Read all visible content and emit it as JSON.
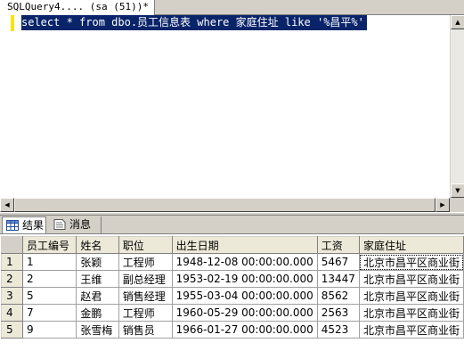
{
  "document_tab": {
    "label": "SQLQuery4....  (sa (51))*"
  },
  "editor": {
    "sql": "select * from dbo.员工信息表 where 家庭住址 like '%昌平%'"
  },
  "results_tabs": [
    {
      "label": "结果",
      "icon": "grid-icon"
    },
    {
      "label": "消息",
      "icon": "messages-icon"
    }
  ],
  "grid": {
    "columns": [
      "员工编号",
      "姓名",
      "职位",
      "出生日期",
      "工资",
      "家庭住址"
    ],
    "rows": [
      {
        "num": "1",
        "cells": [
          "1",
          "张颖",
          "工程师",
          "1948-12-08 00:00:00.000",
          "5467",
          "北京市昌平区商业街"
        ]
      },
      {
        "num": "2",
        "cells": [
          "2",
          "王维",
          "副总经理",
          "1953-02-19 00:00:00.000",
          "13447",
          "北京市昌平区商业街"
        ]
      },
      {
        "num": "3",
        "cells": [
          "5",
          "赵君",
          "销售经理",
          "1955-03-04 00:00:00.000",
          "8562",
          "北京市昌平区商业街"
        ]
      },
      {
        "num": "4",
        "cells": [
          "7",
          "金鹏",
          "工程师",
          "1960-05-29 00:00:00.000",
          "2563",
          "北京市昌平区商业街"
        ]
      },
      {
        "num": "5",
        "cells": [
          "9",
          "张雪梅",
          "销售员",
          "1966-01-27 00:00:00.000",
          "4523",
          "北京市昌平区商业街"
        ]
      }
    ]
  },
  "colors": {
    "selection": "#0a246a",
    "change_bar": "#f5e50a",
    "chrome": "#d4d0c8"
  }
}
